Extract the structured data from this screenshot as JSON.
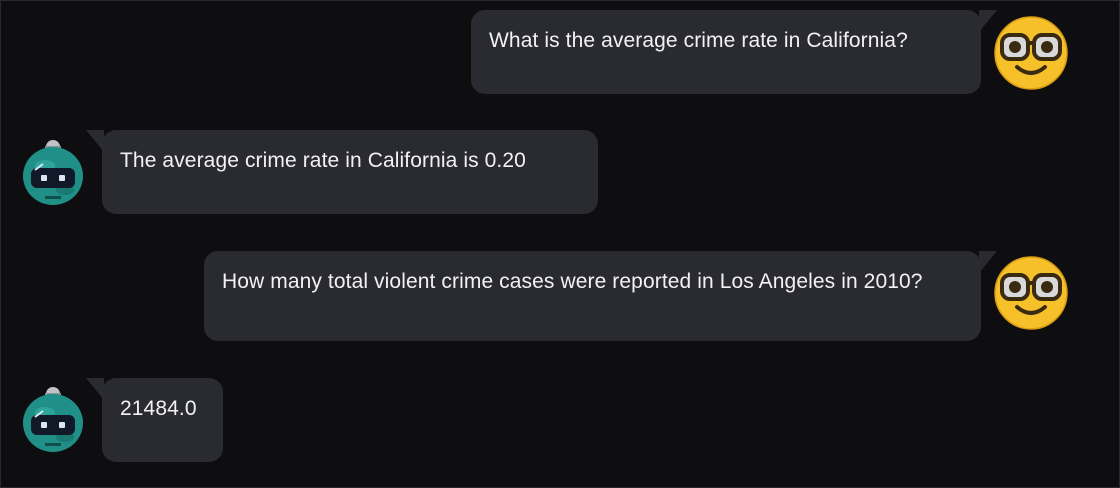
{
  "colors": {
    "background": "#0e0e10",
    "bubble": "#2a2a31",
    "text": "#f2f2f4",
    "user_avatar": "#f5c02a",
    "bot_avatar": "#1f8f87"
  },
  "messages": [
    {
      "role": "user",
      "avatar_icon": "nerd-face-icon",
      "text": "What is the average crime rate in California?"
    },
    {
      "role": "bot",
      "avatar_icon": "robot-icon",
      "text": "The average crime rate in California is 0.20"
    },
    {
      "role": "user",
      "avatar_icon": "nerd-face-icon",
      "text": "How many total violent crime cases were reported in Los Angeles in 2010?"
    },
    {
      "role": "bot",
      "avatar_icon": "robot-icon",
      "text": "21484.0"
    }
  ]
}
